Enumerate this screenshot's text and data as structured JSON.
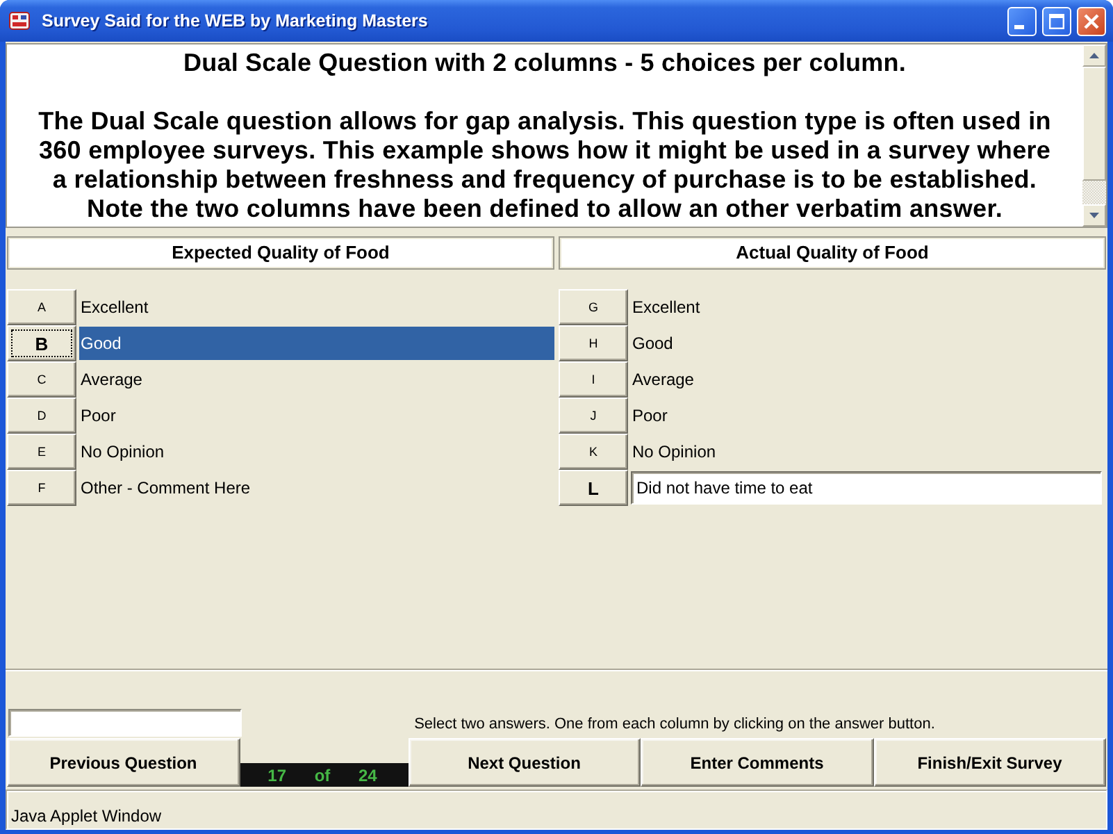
{
  "window": {
    "title": "Survey Said for the WEB by Marketing Masters"
  },
  "question": {
    "heading": "Dual Scale Question with 2 columns - 5 choices per column.",
    "text": "The Dual Scale question allows for gap analysis. This question type is often used in 360 employee surveys. This example shows how it might be used in a survey where a relationship between freshness and frequency of purchase is to be established. Note the two columns have been defined to allow an other verbatim answer."
  },
  "columns": [
    {
      "header": "Expected Quality of Food",
      "choices": [
        {
          "key": "A",
          "kind": "choice",
          "label": "Excellent",
          "selected": false,
          "focused": false
        },
        {
          "key": "B",
          "kind": "choice",
          "label": "Good",
          "selected": true,
          "focused": true
        },
        {
          "key": "C",
          "kind": "choice",
          "label": "Average",
          "selected": false,
          "focused": false
        },
        {
          "key": "D",
          "kind": "choice",
          "label": "Poor",
          "selected": false,
          "focused": false
        },
        {
          "key": "E",
          "kind": "choice",
          "label": "No Opinion",
          "selected": false,
          "focused": false
        },
        {
          "key": "F",
          "kind": "other",
          "label": "Other - Comment Here",
          "selected": false,
          "focused": false
        }
      ]
    },
    {
      "header": "Actual Quality of Food",
      "choices": [
        {
          "key": "G",
          "kind": "choice",
          "label": "Excellent",
          "selected": false,
          "focused": false
        },
        {
          "key": "H",
          "kind": "choice",
          "label": "Good",
          "selected": false,
          "focused": false
        },
        {
          "key": "I",
          "kind": "choice",
          "label": "Average",
          "selected": false,
          "focused": false
        },
        {
          "key": "J",
          "kind": "choice",
          "label": "Poor",
          "selected": false,
          "focused": false
        },
        {
          "key": "K",
          "kind": "choice",
          "label": "No Opinion",
          "selected": false,
          "focused": false
        },
        {
          "key": "L",
          "kind": "other",
          "value": "Did not have time to eat",
          "selected": true,
          "focused": false
        }
      ]
    }
  ],
  "instruction": "Select two answers. One from each column by clicking on the answer button.",
  "toolbar": [
    {
      "kind": "button",
      "label": "Previous Question"
    },
    {
      "kind": "counter",
      "current": "17",
      "separator": "of",
      "total": "24"
    },
    {
      "kind": "button",
      "label": "Next Question"
    },
    {
      "kind": "button",
      "label": "Enter Comments"
    },
    {
      "kind": "button",
      "label": "Finish/Exit Survey"
    }
  ],
  "status_bar": "Java Applet Window"
}
